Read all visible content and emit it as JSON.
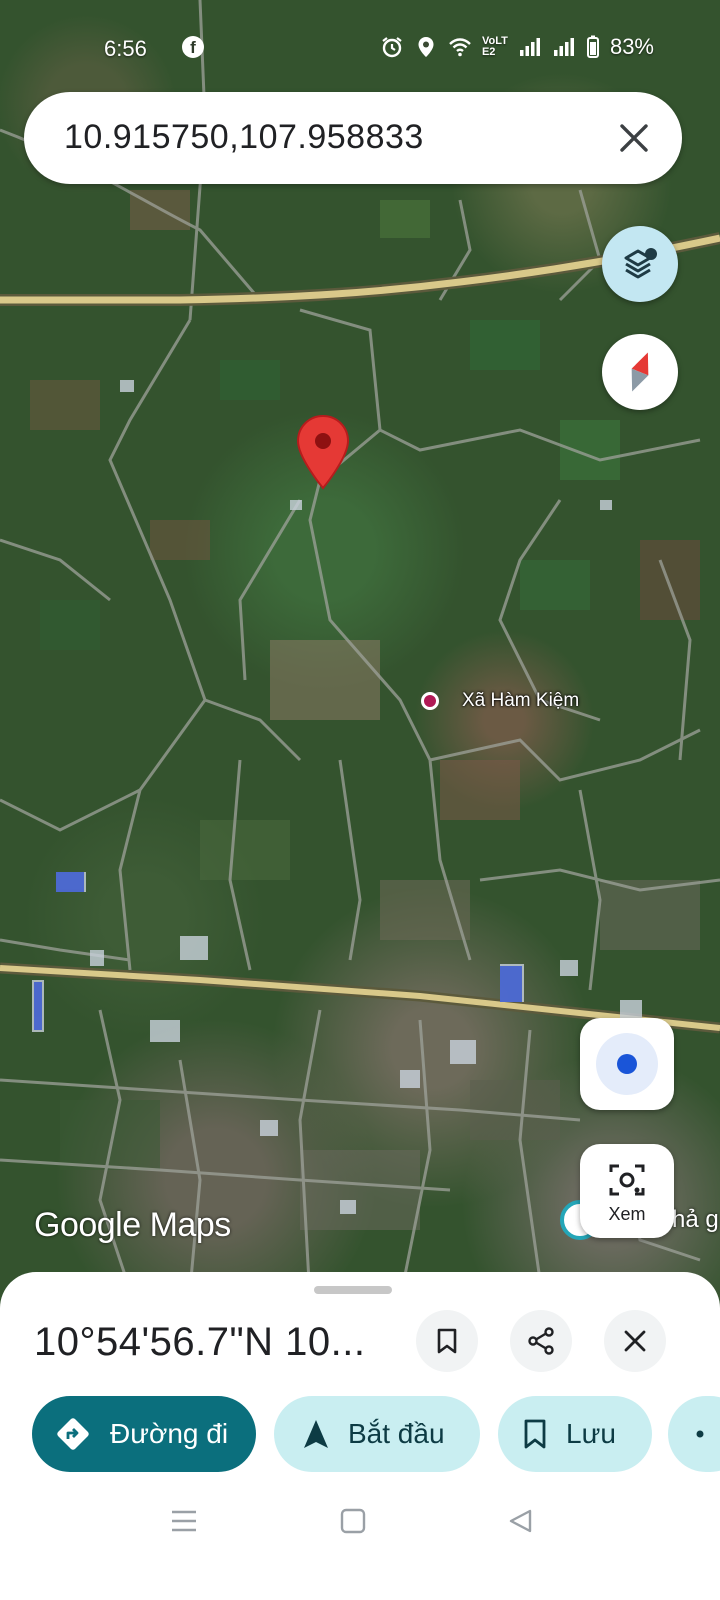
{
  "status_bar": {
    "time": "6:56",
    "app_notification_icon": "facebook-icon",
    "icons": [
      "alarm-icon",
      "location-icon",
      "wifi-icon",
      "volte-icon",
      "signal-icon",
      "signal-icon",
      "battery-icon"
    ],
    "volte_text": "VoLTE2",
    "battery": "83%"
  },
  "search": {
    "query": "10.915750,107.958833",
    "clear_icon": "close-icon"
  },
  "map": {
    "poi_name": "Xã Hàm Kiệm",
    "watermark_google": "Google",
    "watermark_maps": "Maps",
    "partial_label": "hả g",
    "pin_color": "#e53935",
    "road_color": "#d9c98a"
  },
  "controls": {
    "layers_icon": "layers-icon",
    "compass_icon": "compass-icon",
    "my_location_icon": "my-location-icon",
    "lens_label": "Xem"
  },
  "sheet": {
    "title": "10°54'56.7\"N 10...",
    "actions": {
      "directions": "Đường đi",
      "start": "Bắt đầu",
      "save": "Lưu"
    },
    "accent_color": "#0b6f7d",
    "chip_color": "#c9eef1"
  },
  "system_nav": [
    "menu-icon",
    "home-icon",
    "back-icon"
  ]
}
